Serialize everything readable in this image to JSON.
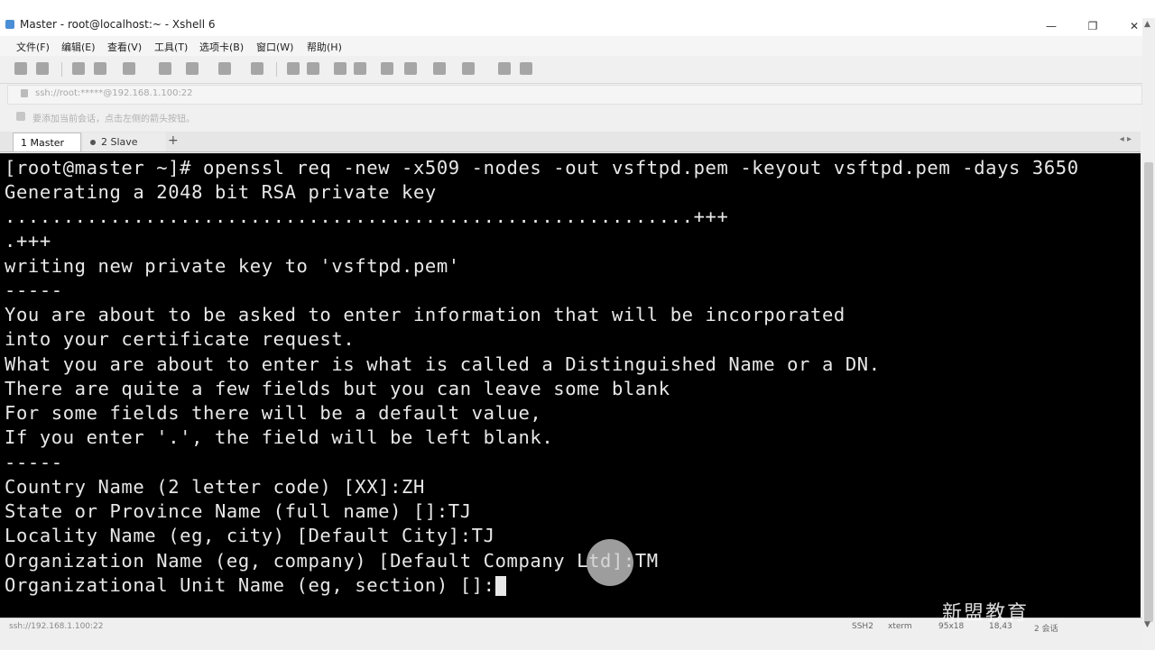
{
  "window": {
    "title": "Master - root@localhost:~ - Xshell 6"
  },
  "window_controls": {
    "minimize": "—",
    "restore": "❐",
    "close": "✕"
  },
  "menu": [
    "文件(F)",
    "编辑(E)",
    "查看(V)",
    "工具(T)",
    "选项卡(B)",
    "窗口(W)",
    "帮助(H)"
  ],
  "address": {
    "text": "ssh://root:*****@192.168.1.100:22"
  },
  "hint": {
    "text": "要添加当前会话，点击左侧的箭头按钮。"
  },
  "tabs": [
    {
      "label": "1 Master",
      "active": true
    },
    {
      "label": "2 Slave",
      "active": false
    }
  ],
  "tab_add": "+",
  "tab_scroll": "◂ ▸",
  "terminal": {
    "lines": [
      "[root@master ~]# openssl req -new -x509 -nodes -out vsftpd.pem -keyout vsftpd.pem -days 3650",
      "Generating a 2048 bit RSA private key",
      "...........................................................+++",
      ".+++",
      "writing new private key to 'vsftpd.pem'",
      "-----",
      "You are about to be asked to enter information that will be incorporated",
      "into your certificate request.",
      "What you are about to enter is what is called a Distinguished Name or a DN.",
      "There are quite a few fields but you can leave some blank",
      "For some fields there will be a default value,",
      "If you enter '.', the field will be left blank.",
      "-----",
      "Country Name (2 letter code) [XX]:ZH",
      "State or Province Name (full name) []:TJ",
      "Locality Name (eg, city) [Default City]:TJ",
      "Organization Name (eg, company) [Default Company Ltd]:TM",
      "Organizational Unit Name (eg, section) []:"
    ]
  },
  "status": {
    "left": "ssh://192.168.1.100:22",
    "protocol": "SSH2",
    "term": "xterm",
    "size": "95x18",
    "pos": "18,43",
    "sessions": "2 会话"
  },
  "watermark": "新盟教育",
  "colors": {
    "terminal_bg": "#000000",
    "terminal_fg": "#e8e8e8",
    "accent": "#4a8fd6"
  }
}
